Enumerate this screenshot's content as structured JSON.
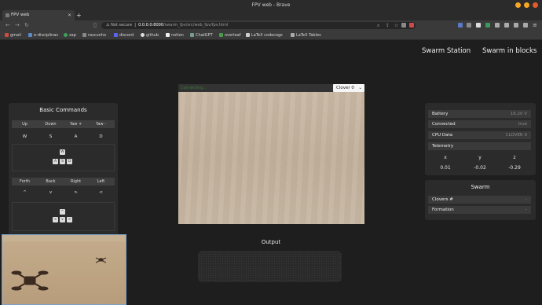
{
  "browser": {
    "window_title": "FPV web - Brave",
    "tab_title": "FPV web",
    "url_security": "Not secure",
    "url_host": "0.0.0.0:8000",
    "url_path": "/swarm_fpv/src/web_fpv/fpv.html",
    "bookmarks": [
      "gmail",
      "e-disciplinas",
      "zap",
      "rascunho",
      "discord",
      "github",
      "notion",
      "ChatGPT",
      "overleaf",
      "LaTeX codecogs",
      "LaTeX Tables"
    ]
  },
  "nav": {
    "swarm_station": "Swarm Station",
    "swarm_in_blocks": "Swarm in blocks"
  },
  "basic_commands": {
    "title": "Basic Commands",
    "row1_headers": [
      "Up",
      "Down",
      "Yaw +",
      "Yaw -"
    ],
    "row1_keys": [
      "W",
      "S",
      "A",
      "D"
    ],
    "wasd": [
      "W",
      "A",
      "S",
      "D"
    ],
    "row2_headers": [
      "Forth",
      "Back",
      "Right",
      "Left"
    ],
    "row2_keys": [
      "^",
      "v",
      ">",
      "<"
    ],
    "arrows": [
      "^",
      "<",
      "v",
      ">"
    ]
  },
  "video": {
    "status": "Connecting...",
    "selected_clover": "Clover 0"
  },
  "output": {
    "title": "Output"
  },
  "status_panel": {
    "battery_label": "Battery",
    "battery_value": "16.20 V",
    "connected_label": "Connected",
    "connected_value": "true",
    "cpu_label": "CPU Data",
    "cpu_value": "CLOVER 0",
    "telemetry_label": "Telemetry",
    "axes": [
      "x",
      "y",
      "z"
    ],
    "values": [
      "0.01",
      "-0.02",
      "-0.29"
    ]
  },
  "swarm_panel": {
    "title": "Swarm",
    "clovers_label": "Clovers #",
    "clovers_value": "-",
    "formation_label": "Formation",
    "formation_value": "-"
  },
  "colors": {
    "background": "#1e1e1e",
    "panel": "#2b2b2b",
    "connecting_text": "#3c7a3c"
  }
}
